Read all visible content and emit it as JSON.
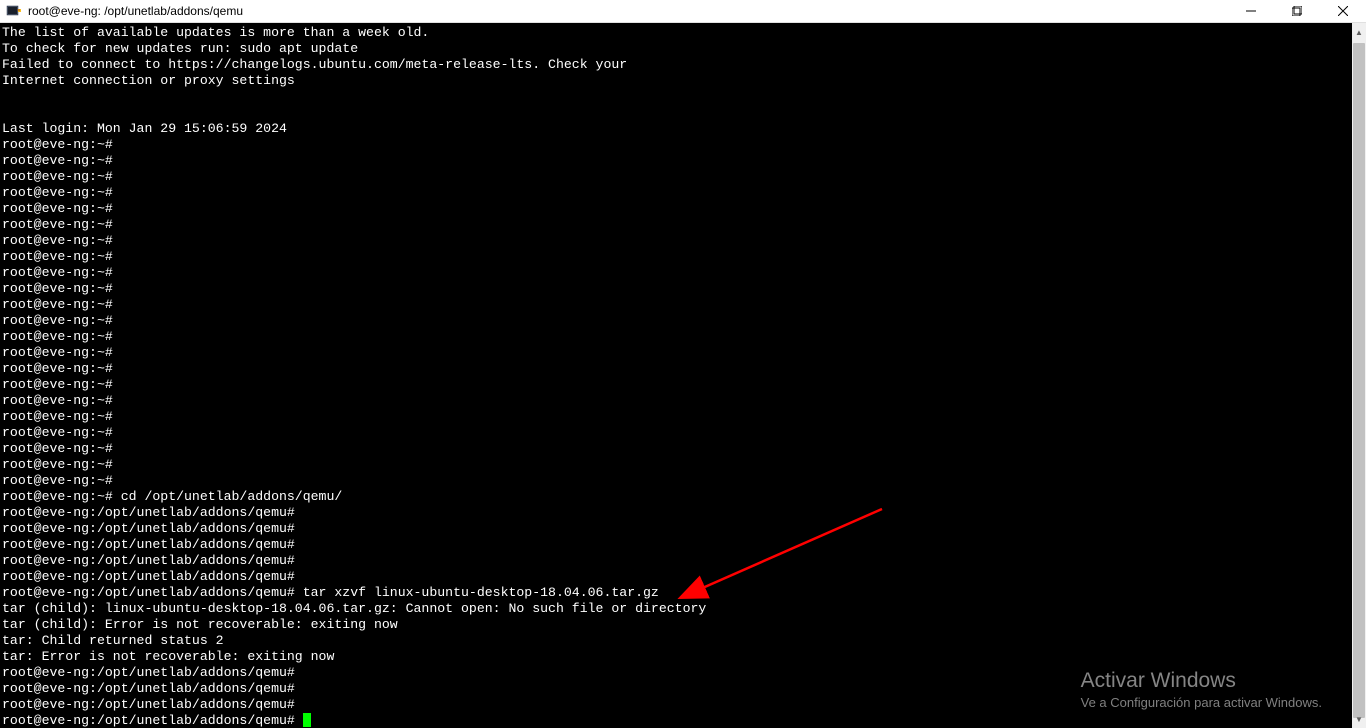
{
  "window": {
    "title": "root@eve-ng: /opt/unetlab/addons/qemu"
  },
  "terminal": {
    "lines": [
      "The list of available updates is more than a week old.",
      "To check for new updates run: sudo apt update",
      "Failed to connect to https://changelogs.ubuntu.com/meta-release-lts. Check your",
      "Internet connection or proxy settings",
      "",
      "",
      "Last login: Mon Jan 29 15:06:59 2024",
      "root@eve-ng:~#",
      "root@eve-ng:~#",
      "root@eve-ng:~#",
      "root@eve-ng:~#",
      "root@eve-ng:~#",
      "root@eve-ng:~#",
      "root@eve-ng:~#",
      "root@eve-ng:~#",
      "root@eve-ng:~#",
      "root@eve-ng:~#",
      "root@eve-ng:~#",
      "root@eve-ng:~#",
      "root@eve-ng:~#",
      "root@eve-ng:~#",
      "root@eve-ng:~#",
      "root@eve-ng:~#",
      "root@eve-ng:~#",
      "root@eve-ng:~#",
      "root@eve-ng:~#",
      "root@eve-ng:~#",
      "root@eve-ng:~#",
      "root@eve-ng:~#",
      "root@eve-ng:~# cd /opt/unetlab/addons/qemu/",
      "root@eve-ng:/opt/unetlab/addons/qemu#",
      "root@eve-ng:/opt/unetlab/addons/qemu#",
      "root@eve-ng:/opt/unetlab/addons/qemu#",
      "root@eve-ng:/opt/unetlab/addons/qemu#",
      "root@eve-ng:/opt/unetlab/addons/qemu#",
      "root@eve-ng:/opt/unetlab/addons/qemu# tar xzvf linux-ubuntu-desktop-18.04.06.tar.gz",
      "tar (child): linux-ubuntu-desktop-18.04.06.tar.gz: Cannot open: No such file or directory",
      "tar (child): Error is not recoverable: exiting now",
      "tar: Child returned status 2",
      "tar: Error is not recoverable: exiting now",
      "root@eve-ng:/opt/unetlab/addons/qemu#",
      "root@eve-ng:/opt/unetlab/addons/qemu#",
      "root@eve-ng:/opt/unetlab/addons/qemu#"
    ],
    "current_prompt": "root@eve-ng:/opt/unetlab/addons/qemu# "
  },
  "watermark": {
    "title": "Activar Windows",
    "subtitle": "Ve a Configuración para activar Windows."
  },
  "annotation": {
    "arrow_color": "#ff0000"
  }
}
